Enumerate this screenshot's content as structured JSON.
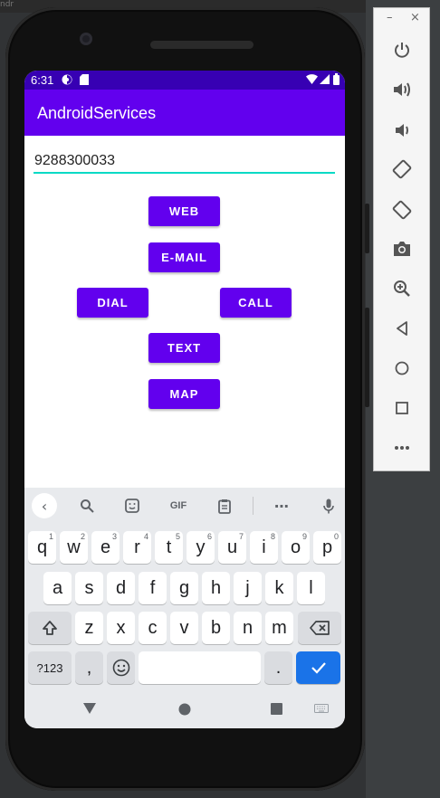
{
  "ide": {
    "fragment": "ndr"
  },
  "status": {
    "time": "6:31"
  },
  "app": {
    "title": "AndroidServices"
  },
  "input": {
    "value": "9288300033"
  },
  "buttons": {
    "web": "WEB",
    "email": "E-MAIL",
    "dial": "DIAL",
    "call": "CALL",
    "text": "TEXT",
    "map": "MAP"
  },
  "keyboard": {
    "gif": "GIF",
    "row1": [
      {
        "k": "q",
        "n": "1"
      },
      {
        "k": "w",
        "n": "2"
      },
      {
        "k": "e",
        "n": "3"
      },
      {
        "k": "r",
        "n": "4"
      },
      {
        "k": "t",
        "n": "5"
      },
      {
        "k": "y",
        "n": "6"
      },
      {
        "k": "u",
        "n": "7"
      },
      {
        "k": "i",
        "n": "8"
      },
      {
        "k": "o",
        "n": "9"
      },
      {
        "k": "p",
        "n": "0"
      }
    ],
    "row2": [
      "a",
      "s",
      "d",
      "f",
      "g",
      "h",
      "j",
      "k",
      "l"
    ],
    "row3": [
      "z",
      "x",
      "c",
      "v",
      "b",
      "n",
      "m"
    ],
    "symbols": "?123",
    "comma": ",",
    "period": "."
  },
  "colors": {
    "primary": "#6200ee",
    "primary_dark": "#3700b3",
    "accent": "#03dac5",
    "enter": "#1a73e8"
  },
  "emulator": {
    "minimize": "–",
    "close": "×",
    "icons": [
      "power-icon",
      "volume-up-icon",
      "volume-down-icon",
      "rotate-left-icon",
      "rotate-right-icon",
      "camera-icon",
      "zoom-icon",
      "back-icon",
      "home-icon",
      "overview-icon",
      "more-icon"
    ]
  }
}
